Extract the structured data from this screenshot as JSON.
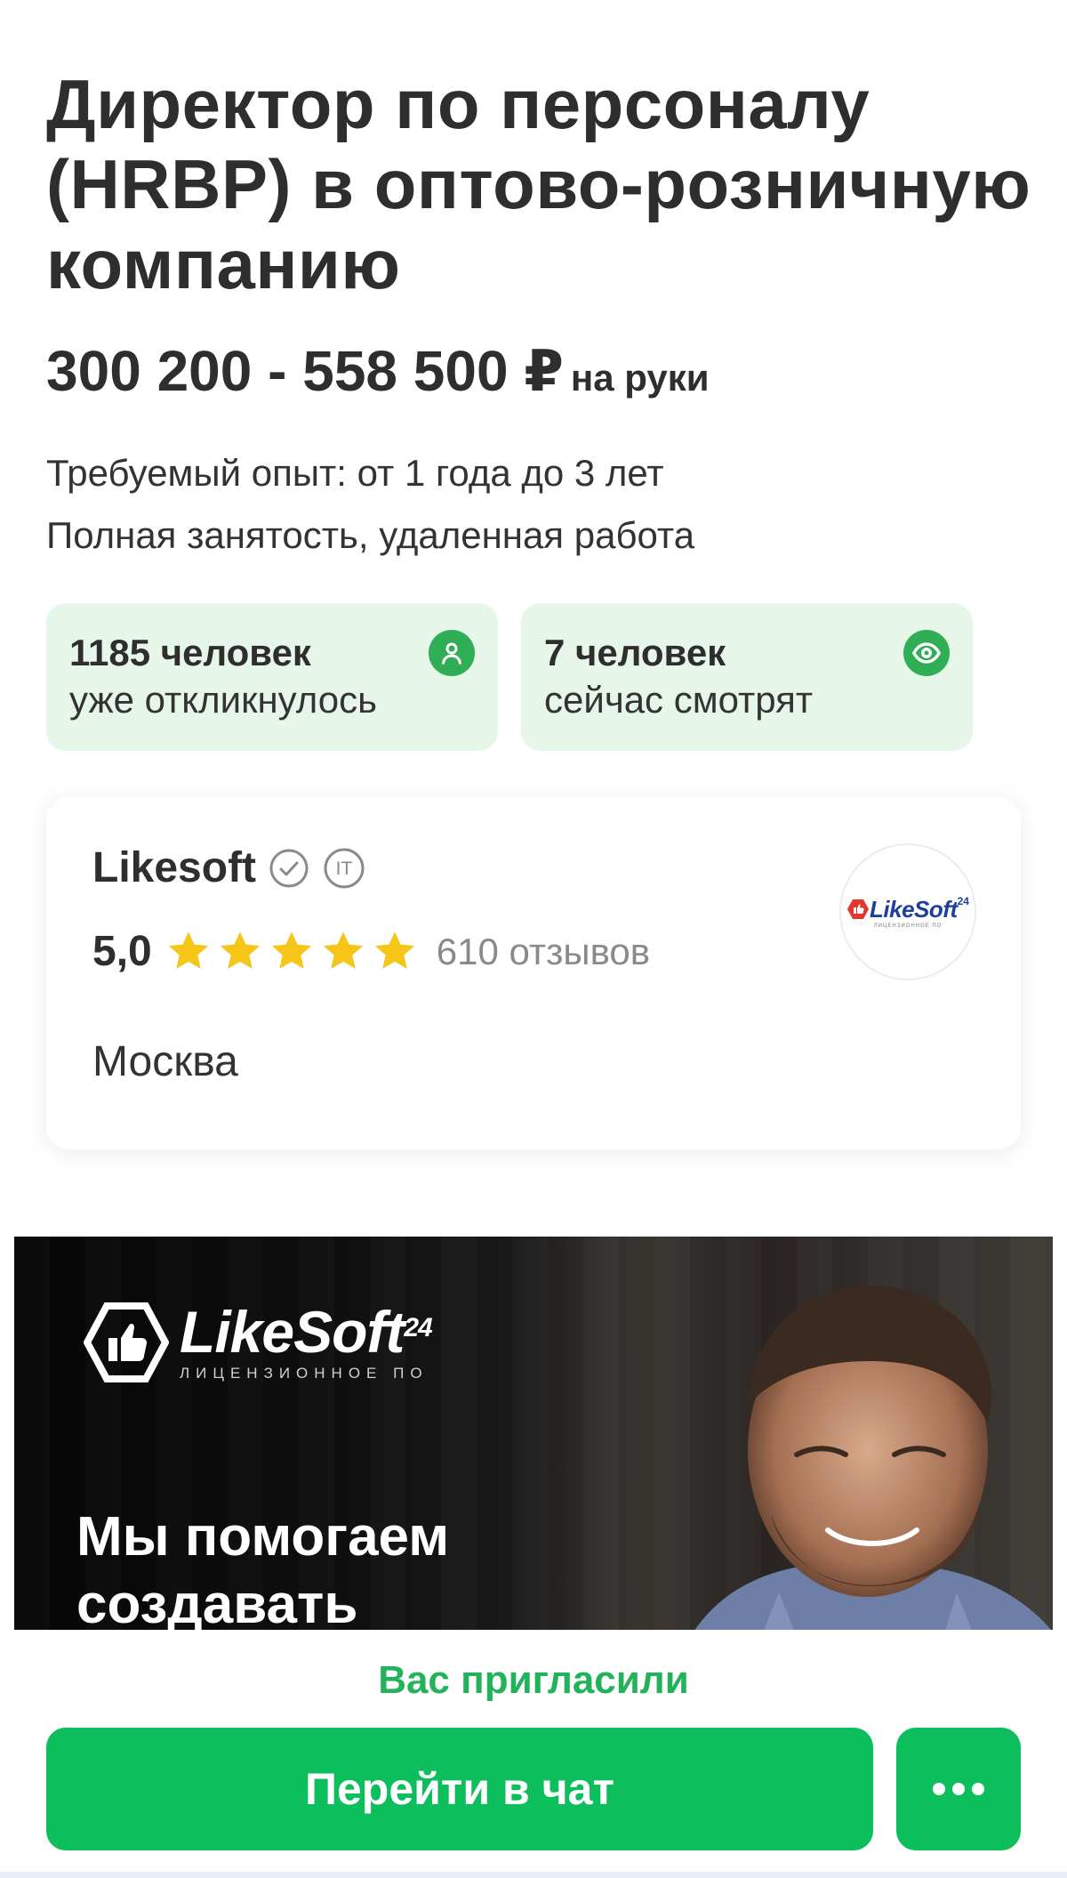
{
  "vacancy": {
    "title": "Директор по персоналу (HRBP) в оптово-розничную компанию",
    "salary": "300 200 - 558 500 ₽",
    "salary_note": "на руки",
    "experience": "Требуемый опыт: от 1 года до 3 лет",
    "employment": "Полная занятость, удаленная работа"
  },
  "stats": {
    "responded_count": "1185 человек",
    "responded_caption": "уже откликнулось",
    "viewing_count": "7 человек",
    "viewing_caption": "сейчас смотрят",
    "responded_icon": "person-icon",
    "viewing_icon": "eye-icon"
  },
  "company": {
    "name": "Likesoft",
    "verified_icon": "verified-check-icon",
    "industry_badge": "IT",
    "rating": "5,0",
    "stars": 5,
    "reviews": "610 отзывов",
    "city": "Москва",
    "logo_text": "LikeSoft",
    "logo_sup": "24",
    "logo_sub": "ЛИЦЕНЗИОННОЕ ПО"
  },
  "banner": {
    "logo_main": "LikeSoft",
    "logo_sup": "24",
    "logo_sub": "ЛИЦЕНЗИОННОЕ ПО",
    "headline": "Мы помогаем создавать"
  },
  "actions": {
    "invite_text": "Вас пригласили",
    "chat_button": "Перейти в чат",
    "more_icon": "more-dots-icon"
  },
  "colors": {
    "accent": "#0dbe5c",
    "accent_text": "#22b35a",
    "stat_bg": "#e6f7ea",
    "star": "#f5c518"
  }
}
